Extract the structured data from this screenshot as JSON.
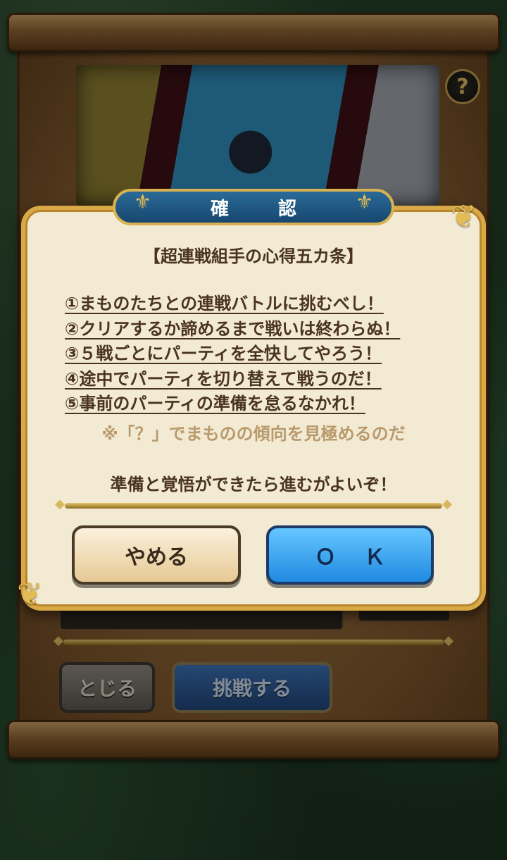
{
  "background": {
    "help_label": "?",
    "close_label": "とじる",
    "challenge_label": "挑戦する"
  },
  "dialog": {
    "title": "確　認",
    "heading": "【超連戦組手の心得五カ条】",
    "rules": [
      "①まものたちとの連戦バトルに挑むべし！",
      "②クリアするか諦めるまで戦いは終わらぬ！",
      "③５戦ごとにパーティを全快してやろう！",
      "④途中でパーティを切り替えて戦うのだ！",
      "⑤事前のパーティの準備を怠るなかれ！"
    ],
    "note": "※「？」でまものの傾向を見極めるのだ",
    "closing": "準備と覚悟ができたら進むがよいぞ！",
    "cancel_label": "やめる",
    "ok_label": "ＯＫ"
  },
  "colors": {
    "parchment": "#f3ead4",
    "gold_frame": "#d9a945",
    "ok_blue": "#1f8ae0",
    "text_brown": "#4a3420",
    "note_tan": "#b89a6c"
  }
}
